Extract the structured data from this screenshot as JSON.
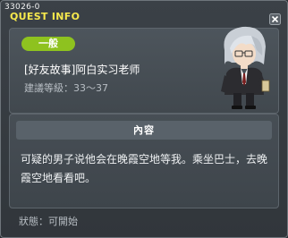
{
  "window": {
    "id_label": "33026-0",
    "title": "QUEST INFO"
  },
  "quest": {
    "category": "一般",
    "name": "[好友故事]阿白实习老师",
    "level_range": "建議等級：33～37"
  },
  "details": {
    "heading": "內容",
    "text": "可疑的男子说他会在晚霞空地等我。乘坐巴士，去晚霞空地看看吧。"
  },
  "status_line": "狀態：可開始",
  "colors": {
    "title": "#f7e94d",
    "category_tag": "#8ec21f",
    "window_bg": "#3b4147"
  },
  "icons": {
    "close": "close-icon",
    "npc": "npc-portrait"
  }
}
